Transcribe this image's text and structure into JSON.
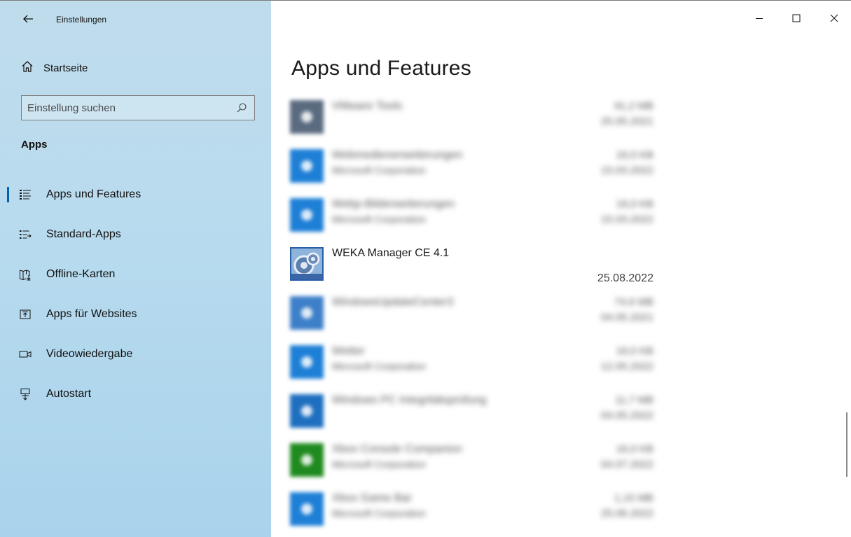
{
  "window": {
    "title": "Einstellungen"
  },
  "sidebar": {
    "home_label": "Startseite",
    "search_placeholder": "Einstellung suchen",
    "section_title": "Apps",
    "items": [
      {
        "label": "Apps und Features",
        "icon": "apps-features-icon",
        "active": true
      },
      {
        "label": "Standard-Apps",
        "icon": "default-apps-icon"
      },
      {
        "label": "Offline-Karten",
        "icon": "offline-maps-icon"
      },
      {
        "label": "Apps für Websites",
        "icon": "apps-for-websites-icon"
      },
      {
        "label": "Videowiedergabe",
        "icon": "video-playback-icon"
      },
      {
        "label": "Autostart",
        "icon": "autostart-icon"
      }
    ]
  },
  "main": {
    "title": "Apps und Features",
    "apps": [
      {
        "name": "VMware Tools",
        "publisher": "",
        "size": "91,2 MB",
        "date": "25.05.2021",
        "blurred": true,
        "icon_color": "#5a6b80"
      },
      {
        "name": "Webmedienerweiterungen",
        "publisher": "Microsoft Corporation",
        "size": "16,0 KB",
        "date": "15.03.2022",
        "blurred": true,
        "icon_color": "#1e7fd6"
      },
      {
        "name": "Webp-Bilderweiterungen",
        "publisher": "Microsoft Corporation",
        "size": "16,0 KB",
        "date": "15.03.2022",
        "blurred": true,
        "icon_color": "#1e7fd6"
      },
      {
        "name": "WEKA Manager CE 4.1",
        "publisher": "",
        "size": "",
        "date": "25.08.2022",
        "blurred": false,
        "icon_color": "#2a5fa8"
      },
      {
        "name": "WindowsUpdateCenter3",
        "publisher": "",
        "size": "74,6 MB",
        "date": "04.05.2021",
        "blurred": true,
        "icon_color": "#3d7fc8"
      },
      {
        "name": "Wetter",
        "publisher": "Microsoft Corporation",
        "size": "16,0 KB",
        "date": "12.05.2022",
        "blurred": true,
        "icon_color": "#1e7fd6"
      },
      {
        "name": "Windows PC Integritätsprüfung",
        "publisher": "",
        "size": "11,7 MB",
        "date": "04.05.2022",
        "blurred": true,
        "icon_color": "#1e6fc0"
      },
      {
        "name": "Xbox Console Companion",
        "publisher": "Microsoft Corporation",
        "size": "16,0 KB",
        "date": "04.07.2022",
        "blurred": true,
        "icon_color": "#1f8a1f"
      },
      {
        "name": "Xbox Game Bar",
        "publisher": "Microsoft Corporation",
        "size": "1,15 MB",
        "date": "25.06.2022",
        "blurred": true,
        "icon_color": "#1e7fd6"
      }
    ]
  },
  "colors": {
    "sidebar_bg": "#b9dbee",
    "accent": "#0063b1"
  }
}
